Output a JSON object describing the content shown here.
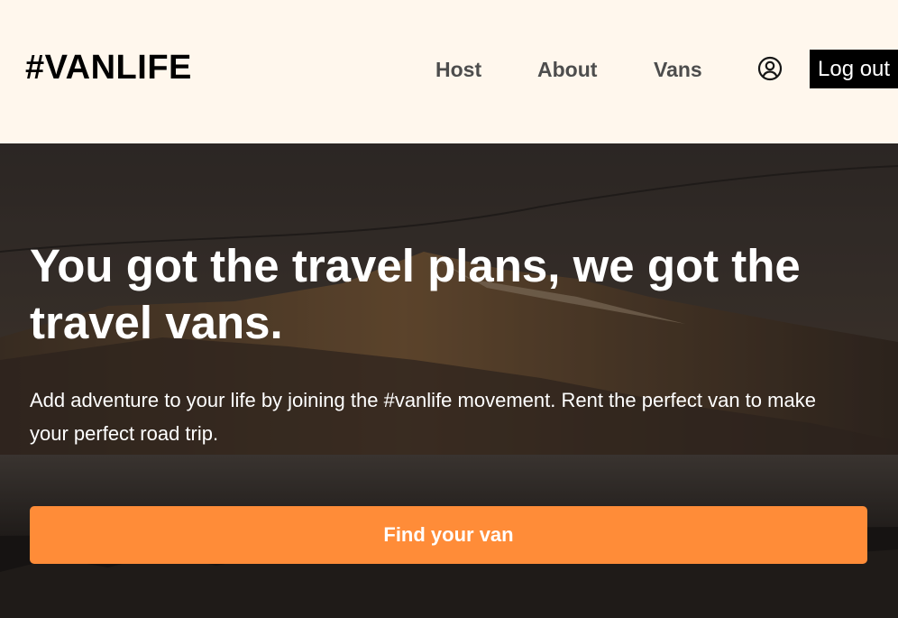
{
  "header": {
    "logo": "#VANLIFE",
    "nav": {
      "host": "Host",
      "about": "About",
      "vans": "Vans"
    },
    "user_icon": "user-circle-icon",
    "logout_label": "Log out"
  },
  "hero": {
    "title": "You got the travel plans, we got the travel vans.",
    "subtitle": "Add adventure to your life by joining the #vanlife movement. Rent the perfect van to make your perfect road trip.",
    "cta_label": "Find your van"
  },
  "colors": {
    "header_bg": "#FFF7ED",
    "accent": "#FF8C38",
    "nav_text": "#4D4D4D",
    "logout_bg": "#000000"
  }
}
